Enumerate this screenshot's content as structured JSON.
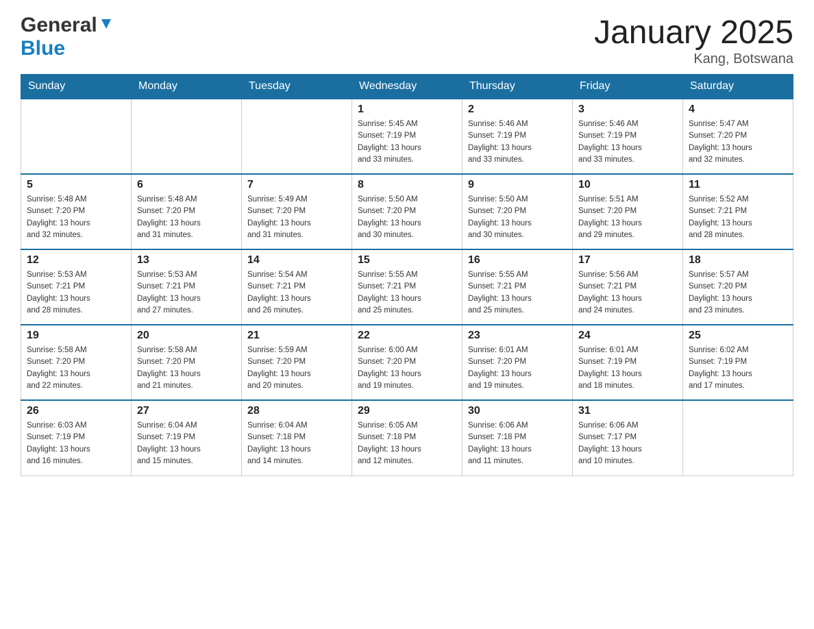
{
  "header": {
    "title": "January 2025",
    "location": "Kang, Botswana",
    "logo_general": "General",
    "logo_blue": "Blue"
  },
  "days_of_week": [
    "Sunday",
    "Monday",
    "Tuesday",
    "Wednesday",
    "Thursday",
    "Friday",
    "Saturday"
  ],
  "weeks": [
    {
      "days": [
        {
          "date": "",
          "info": ""
        },
        {
          "date": "",
          "info": ""
        },
        {
          "date": "",
          "info": ""
        },
        {
          "date": "1",
          "info": "Sunrise: 5:45 AM\nSunset: 7:19 PM\nDaylight: 13 hours\nand 33 minutes."
        },
        {
          "date": "2",
          "info": "Sunrise: 5:46 AM\nSunset: 7:19 PM\nDaylight: 13 hours\nand 33 minutes."
        },
        {
          "date": "3",
          "info": "Sunrise: 5:46 AM\nSunset: 7:19 PM\nDaylight: 13 hours\nand 33 minutes."
        },
        {
          "date": "4",
          "info": "Sunrise: 5:47 AM\nSunset: 7:20 PM\nDaylight: 13 hours\nand 32 minutes."
        }
      ]
    },
    {
      "days": [
        {
          "date": "5",
          "info": "Sunrise: 5:48 AM\nSunset: 7:20 PM\nDaylight: 13 hours\nand 32 minutes."
        },
        {
          "date": "6",
          "info": "Sunrise: 5:48 AM\nSunset: 7:20 PM\nDaylight: 13 hours\nand 31 minutes."
        },
        {
          "date": "7",
          "info": "Sunrise: 5:49 AM\nSunset: 7:20 PM\nDaylight: 13 hours\nand 31 minutes."
        },
        {
          "date": "8",
          "info": "Sunrise: 5:50 AM\nSunset: 7:20 PM\nDaylight: 13 hours\nand 30 minutes."
        },
        {
          "date": "9",
          "info": "Sunrise: 5:50 AM\nSunset: 7:20 PM\nDaylight: 13 hours\nand 30 minutes."
        },
        {
          "date": "10",
          "info": "Sunrise: 5:51 AM\nSunset: 7:20 PM\nDaylight: 13 hours\nand 29 minutes."
        },
        {
          "date": "11",
          "info": "Sunrise: 5:52 AM\nSunset: 7:21 PM\nDaylight: 13 hours\nand 28 minutes."
        }
      ]
    },
    {
      "days": [
        {
          "date": "12",
          "info": "Sunrise: 5:53 AM\nSunset: 7:21 PM\nDaylight: 13 hours\nand 28 minutes."
        },
        {
          "date": "13",
          "info": "Sunrise: 5:53 AM\nSunset: 7:21 PM\nDaylight: 13 hours\nand 27 minutes."
        },
        {
          "date": "14",
          "info": "Sunrise: 5:54 AM\nSunset: 7:21 PM\nDaylight: 13 hours\nand 26 minutes."
        },
        {
          "date": "15",
          "info": "Sunrise: 5:55 AM\nSunset: 7:21 PM\nDaylight: 13 hours\nand 25 minutes."
        },
        {
          "date": "16",
          "info": "Sunrise: 5:55 AM\nSunset: 7:21 PM\nDaylight: 13 hours\nand 25 minutes."
        },
        {
          "date": "17",
          "info": "Sunrise: 5:56 AM\nSunset: 7:21 PM\nDaylight: 13 hours\nand 24 minutes."
        },
        {
          "date": "18",
          "info": "Sunrise: 5:57 AM\nSunset: 7:20 PM\nDaylight: 13 hours\nand 23 minutes."
        }
      ]
    },
    {
      "days": [
        {
          "date": "19",
          "info": "Sunrise: 5:58 AM\nSunset: 7:20 PM\nDaylight: 13 hours\nand 22 minutes."
        },
        {
          "date": "20",
          "info": "Sunrise: 5:58 AM\nSunset: 7:20 PM\nDaylight: 13 hours\nand 21 minutes."
        },
        {
          "date": "21",
          "info": "Sunrise: 5:59 AM\nSunset: 7:20 PM\nDaylight: 13 hours\nand 20 minutes."
        },
        {
          "date": "22",
          "info": "Sunrise: 6:00 AM\nSunset: 7:20 PM\nDaylight: 13 hours\nand 19 minutes."
        },
        {
          "date": "23",
          "info": "Sunrise: 6:01 AM\nSunset: 7:20 PM\nDaylight: 13 hours\nand 19 minutes."
        },
        {
          "date": "24",
          "info": "Sunrise: 6:01 AM\nSunset: 7:19 PM\nDaylight: 13 hours\nand 18 minutes."
        },
        {
          "date": "25",
          "info": "Sunrise: 6:02 AM\nSunset: 7:19 PM\nDaylight: 13 hours\nand 17 minutes."
        }
      ]
    },
    {
      "days": [
        {
          "date": "26",
          "info": "Sunrise: 6:03 AM\nSunset: 7:19 PM\nDaylight: 13 hours\nand 16 minutes."
        },
        {
          "date": "27",
          "info": "Sunrise: 6:04 AM\nSunset: 7:19 PM\nDaylight: 13 hours\nand 15 minutes."
        },
        {
          "date": "28",
          "info": "Sunrise: 6:04 AM\nSunset: 7:18 PM\nDaylight: 13 hours\nand 14 minutes."
        },
        {
          "date": "29",
          "info": "Sunrise: 6:05 AM\nSunset: 7:18 PM\nDaylight: 13 hours\nand 12 minutes."
        },
        {
          "date": "30",
          "info": "Sunrise: 6:06 AM\nSunset: 7:18 PM\nDaylight: 13 hours\nand 11 minutes."
        },
        {
          "date": "31",
          "info": "Sunrise: 6:06 AM\nSunset: 7:17 PM\nDaylight: 13 hours\nand 10 minutes."
        },
        {
          "date": "",
          "info": ""
        }
      ]
    }
  ]
}
